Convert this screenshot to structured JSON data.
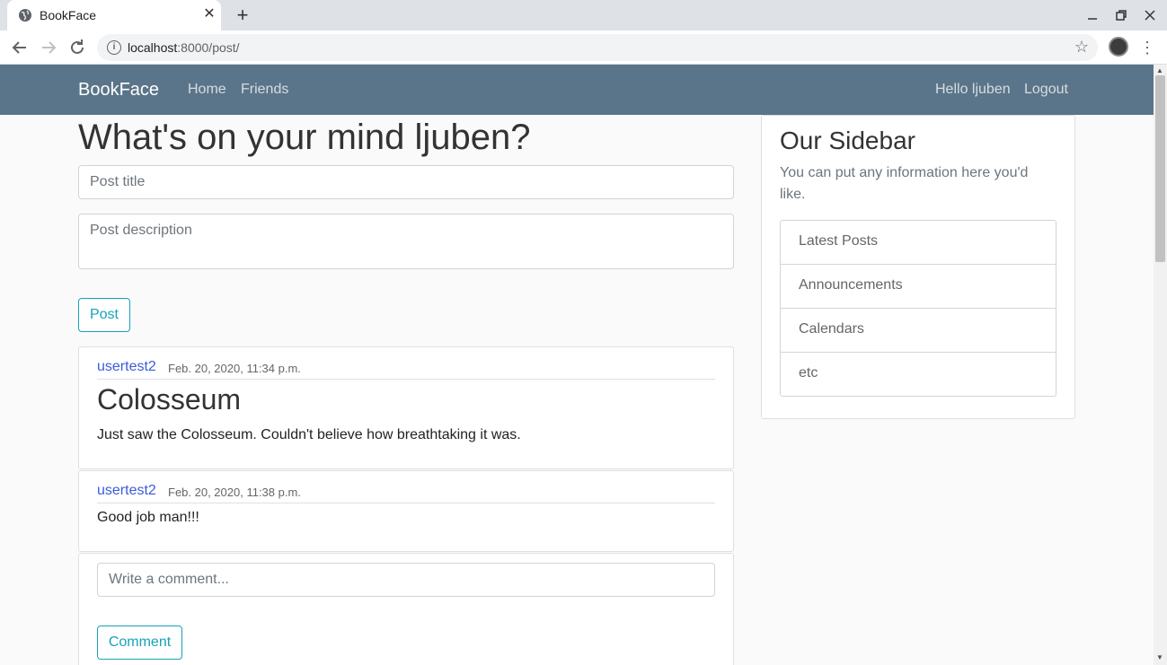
{
  "browser": {
    "tab_title": "BookFace",
    "url_host": "localhost",
    "url_rest": ":8000/post/",
    "new_tab_symbol": "+",
    "close_symbol": "✕"
  },
  "navbar": {
    "brand": "BookFace",
    "links": [
      "Home",
      "Friends"
    ],
    "greeting": "Hello ljuben",
    "logout": "Logout",
    "bg_color": "#5a7589"
  },
  "main": {
    "heading": "What's on your mind ljuben?",
    "title_placeholder": "Post title",
    "description_placeholder": "Post description",
    "post_button": "Post"
  },
  "posts": [
    {
      "author": "usertest2",
      "date": "Feb. 20, 2020, 11:34 p.m.",
      "title": "Colosseum",
      "body": "Just saw the Colosseum. Couldn't believe how breathtaking it was."
    }
  ],
  "comments": [
    {
      "author": "usertest2",
      "date": "Feb. 20, 2020, 11:38 p.m.",
      "body": "Good job man!!!"
    }
  ],
  "comment_form": {
    "placeholder": "Write a comment...",
    "button": "Comment"
  },
  "sidebar": {
    "title": "Our Sidebar",
    "text": "You can put any information here you'd like.",
    "items": [
      "Latest Posts",
      "Announcements",
      "Calendars",
      "etc"
    ]
  },
  "colors": {
    "accent": "#17a2b8",
    "author_link": "#3b5bd9"
  }
}
